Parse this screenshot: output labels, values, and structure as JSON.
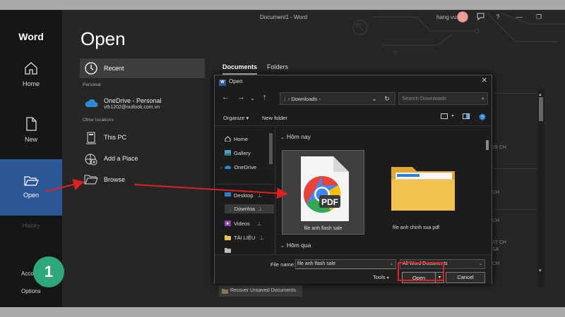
{
  "window": {
    "title": "Document1  -  Word",
    "user": "hang vu",
    "buttons": {
      "help": "?",
      "minimize": "—",
      "restore": "❐"
    }
  },
  "sidebar": {
    "brand": "Word",
    "home": "Home",
    "new": "New",
    "open": "Open",
    "history": "History",
    "account": "Account",
    "options": "Options",
    "step_badge": "1"
  },
  "main": {
    "title": "Open",
    "recent": "Recent",
    "personal_label": "Personal",
    "onedrive_title": "OneDrive - Personal",
    "onedrive_email": "vth1202@outlook.com.vn",
    "other_label": "Other locations",
    "this_pc": "This PC",
    "add_place": "Add a Place",
    "browse": "Browse",
    "tab_documents": "Documents",
    "tab_folders": "Folders",
    "bg_times": [
      "28 CH",
      "CH",
      "CH",
      "37 CH",
      "SA",
      "CH"
    ],
    "recover": "Recover Unsaved Documents"
  },
  "dialog": {
    "title": "Open",
    "close": "✕",
    "address": "Downloads",
    "search_placeholder": "Search Downloads",
    "organize": "Organize ▾",
    "new_folder": "New folder",
    "nav_pane": {
      "home": "Home",
      "gallery": "Gallery",
      "onedrive": "OneDrive",
      "desktop": "Desktop",
      "downloads": "Downloa",
      "videos": "Videos",
      "tailieu": "TÀI LIỆU"
    },
    "group_today": "Hôm nay",
    "group_yesterday": "Hôm qua",
    "files": [
      {
        "name": "file anh flash sale",
        "icon": "pdf-file-icon",
        "badge": "PDF"
      },
      {
        "name": "file anh chinh sua pdf",
        "icon": "folder-icon"
      }
    ],
    "file_name_label": "File name:",
    "file_name_value": "file anh flash sale",
    "file_type": "All Word Documents",
    "tools": "Tools",
    "open_button": "Open",
    "cancel_button": "Cancel"
  },
  "colors": {
    "accent": "#2b5797",
    "badge": "#2ea87a",
    "highlight": "#e02020"
  }
}
